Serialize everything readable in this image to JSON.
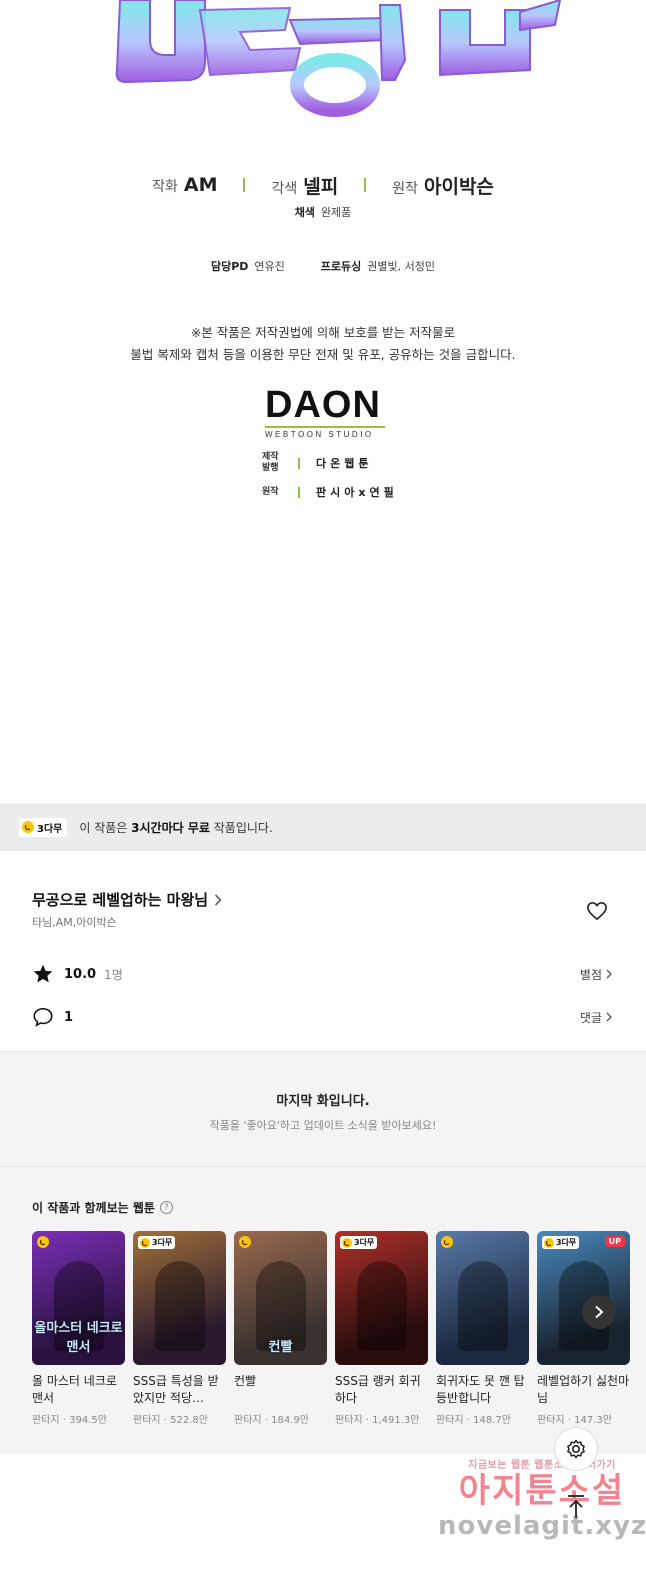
{
  "credits": {
    "author_role": "작화",
    "author_name": "AM",
    "adapt_role": "각색",
    "adapt_name": "넬피",
    "original_role": "원작",
    "original_name": "아이박슨",
    "color_role": "채색",
    "color_name": "완제품",
    "pd_role": "담당PD",
    "pd_name": "연유진",
    "producer_role": "프로듀싱",
    "producer_name": "권별빛, 서정민"
  },
  "copyright": {
    "line1": "※본 작품은 저작권법에 의해 보호를 받는 저작물로",
    "line2": "불법 복제와 캡처 등을 이용한 무단 전재 및 유포, 공유하는 것을 금합니다."
  },
  "studio": {
    "logo": "DAON",
    "logo_sub": "WEBTOON STUDIO",
    "prod_key1": "제작",
    "prod_key2": "발행",
    "prod_val": "다온웹툰",
    "orig_key": "원작",
    "orig_val": "판시아x연필"
  },
  "free_bar": {
    "badge": "3다무",
    "text_prefix": "이 작품은 ",
    "text_bold": "3시간마다 무료",
    "text_suffix": " 작품입니다."
  },
  "series": {
    "title": "무공으로 레벨업하는 마왕님",
    "authors": "타님,AM,아이박슨",
    "rating": "10.0",
    "rating_count": "1명",
    "rating_link": "별점",
    "comments": "1",
    "comments_link": "댓글"
  },
  "last_episode": {
    "title": "마지막 화입니다.",
    "desc": "작품을 '좋아요'하고 업데이트 소식을 받아보세요!"
  },
  "recommendations": {
    "title": "이 작품과 함께보는 웹툰",
    "help_icon": "?",
    "items": [
      {
        "name": "올 마스터 네크로맨서",
        "genre": "판타지",
        "views": "394.5만",
        "badge": "",
        "art": "올마스터 네크로맨서",
        "colors": [
          "#2a1240",
          "#7c2fb8"
        ]
      },
      {
        "name": "SSS급 특성을 받았지만 적당…",
        "genre": "판타지",
        "views": "522.8만",
        "badge": "3다무",
        "art": "",
        "colors": [
          "#2b1a2e",
          "#a0703a"
        ]
      },
      {
        "name": "컨빨",
        "genre": "판타지",
        "views": "184.9만",
        "badge": "",
        "art": "컨빨",
        "colors": [
          "#3a3230",
          "#9a6a50"
        ]
      },
      {
        "name": "SSS급 랭커 회귀하다",
        "genre": "판타지",
        "views": "1,491.3만",
        "badge": "3다무",
        "art": "",
        "colors": [
          "#2a0e0e",
          "#b0302a"
        ]
      },
      {
        "name": "회귀자도 못 깬 탑 등반합니다",
        "genre": "판타지",
        "views": "148.7만",
        "badge": "",
        "art": "",
        "colors": [
          "#1c2a40",
          "#5a7aa8"
        ]
      },
      {
        "name": "레벨업하기 싫천마님",
        "genre": "판타지",
        "views": "147.3만",
        "badge": "3다무",
        "art": "",
        "colors": [
          "#1a2430",
          "#4a8ac0"
        ],
        "up": "UP"
      }
    ]
  },
  "watermark": {
    "top": "지금보는 웹툰 웹툰소설 보러가기",
    "mid": "아지툰소설",
    "bot": "novelagit.xyz"
  },
  "colors": {
    "accent_green": "#8bc34a",
    "badge_yellow": "#ffc400",
    "up_red": "#f0344c"
  }
}
